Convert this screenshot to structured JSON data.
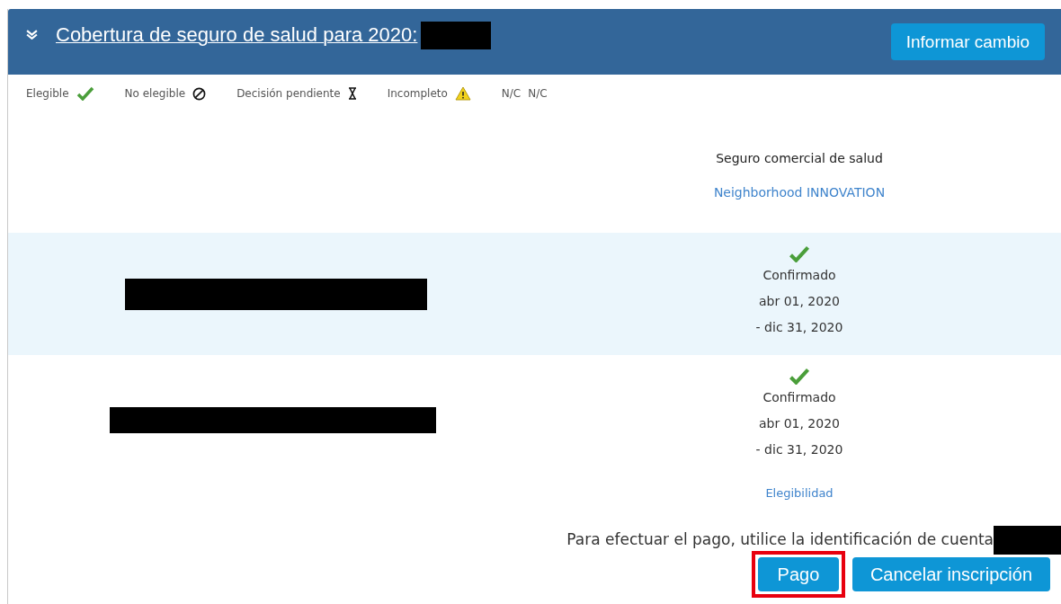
{
  "header": {
    "title": "Cobertura de seguro de salud para 2020:",
    "title_redacted": true,
    "button": "Informar cambio"
  },
  "legend": [
    {
      "label": "Elegible",
      "kind": "eligible"
    },
    {
      "label": "No elegible",
      "kind": "ineligible"
    },
    {
      "label": "Decisión pendiente",
      "kind": "pending"
    },
    {
      "label": "Incompleto",
      "kind": "incomplete"
    },
    {
      "label": "N/C",
      "kind": "na",
      "symbol": "N/C"
    }
  ],
  "column": {
    "heading": "Seguro comercial de salud",
    "plan": "Neighborhood INNOVATION"
  },
  "rows": [
    {
      "shaded": true,
      "name_redacted": true,
      "kind": "eligible",
      "status": "Confirmado",
      "start": "abr 01, 2020",
      "end": "- dic 31, 2020"
    },
    {
      "shaded": false,
      "name_redacted": true,
      "kind": "eligible",
      "status": "Confirmado",
      "start": "abr 01, 2020",
      "end": "- dic 31, 2020"
    }
  ],
  "eligibility_link": "Elegibilidad",
  "payment_note": {
    "text": "Para efectuar el pago, utilice la identificación de cuenta",
    "account_redacted": true
  },
  "buttons": [
    {
      "label": "Pago",
      "highlighted": true
    },
    {
      "label": "Cancelar inscripción",
      "highlighted": false
    }
  ]
}
